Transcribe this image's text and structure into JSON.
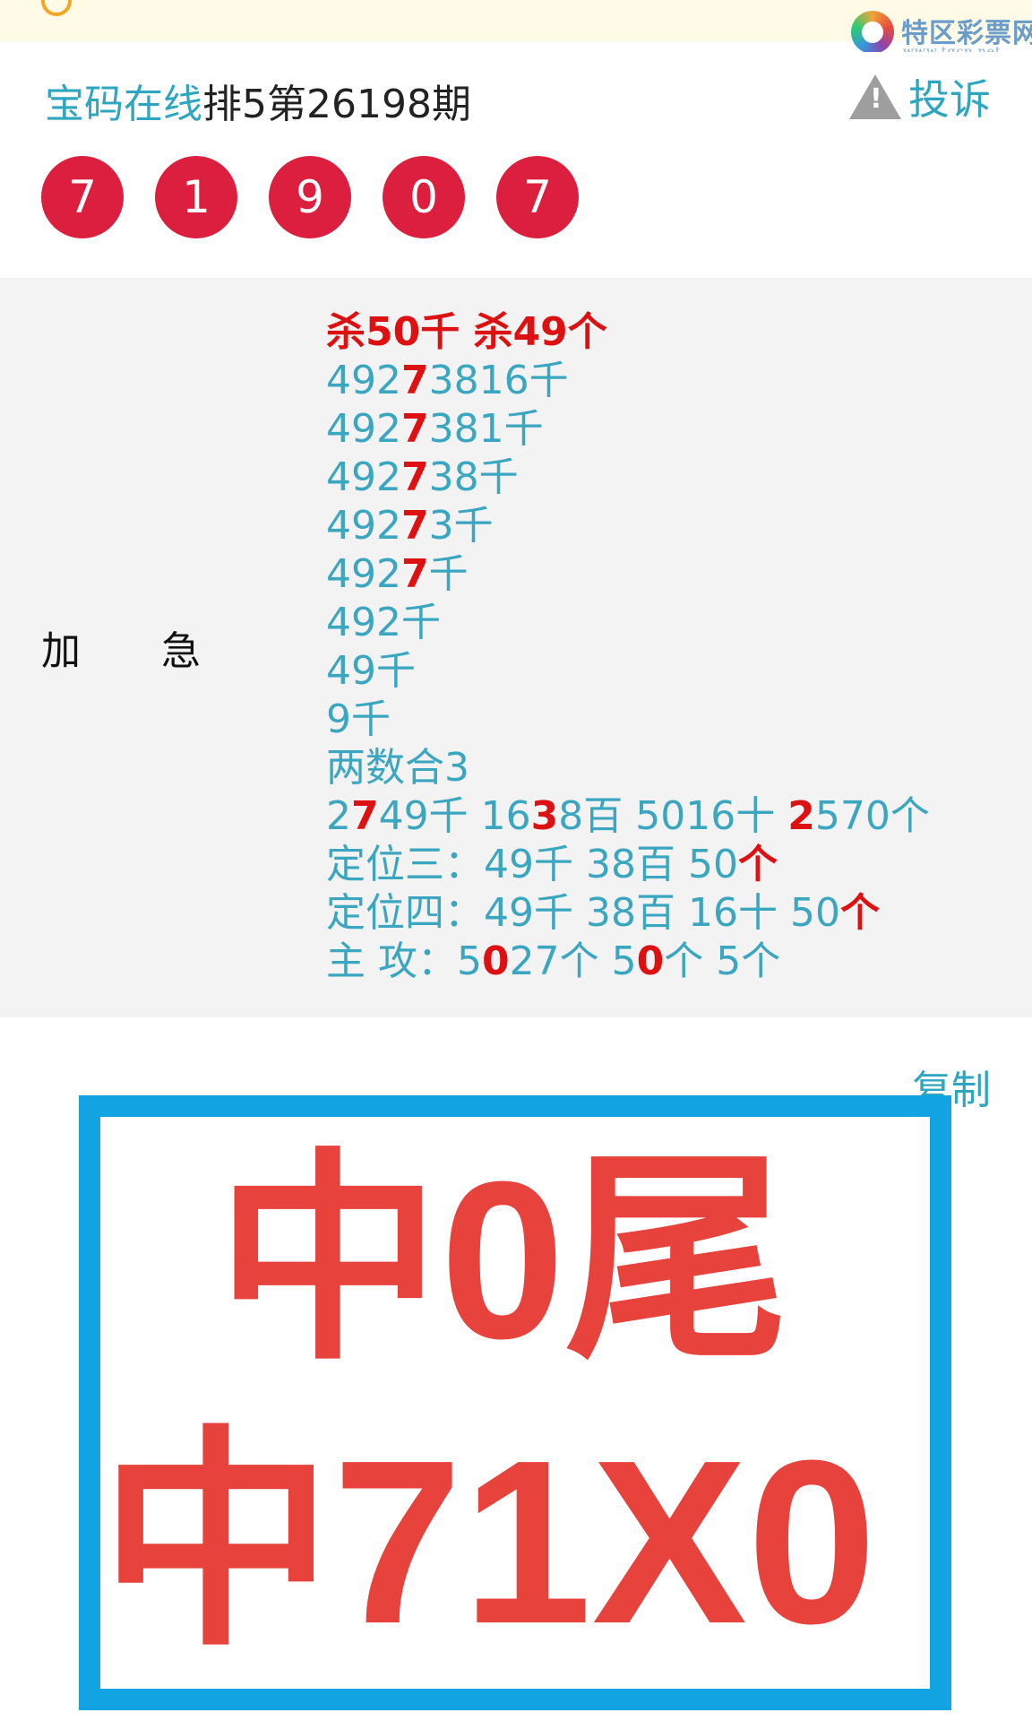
{
  "header": {
    "site_name": "宝码在线",
    "issue_text": "排5第26198期",
    "complain_label": "投诉",
    "warning_icon_glyph": "!"
  },
  "brand_logo": {
    "name": "特区彩票网",
    "url": "www.tqcp.net"
  },
  "draw_result": {
    "numbers": [
      "7",
      "1",
      "9",
      "0",
      "7"
    ],
    "ball_color": "#dc1f3e"
  },
  "forecast": {
    "label": "加急",
    "kill_line": "杀50千 杀49个",
    "lines": [
      "49273816千",
      "4927381千",
      "492738千",
      "49273千",
      "4927千",
      "492千",
      "49千",
      "9千",
      "两数合3",
      "2749千 1638百 5016十 2570个",
      "定位三：49千 38百 50个",
      "定位四：49千 38百 16十 50个",
      "主 攻：5027个 50个 5个"
    ],
    "highlight_color": "#dd1111",
    "text_color": "#3aa6bf"
  },
  "copy_label": "复制",
  "stamp": {
    "line1": "中0尾",
    "line2": "中71X0",
    "border_color": "#12a3e3",
    "text_color": "#e8423c"
  },
  "notice_strip": {
    "icon": "bell-icon"
  }
}
